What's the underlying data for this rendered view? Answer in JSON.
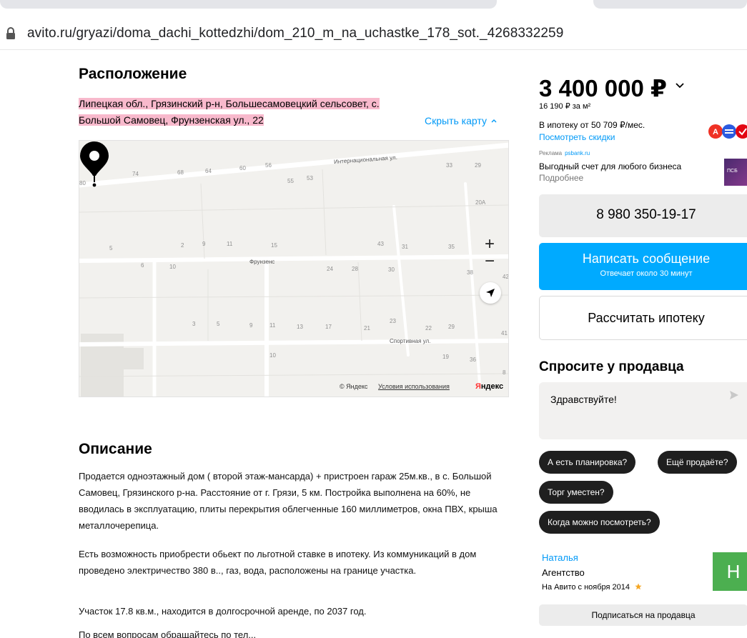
{
  "browser": {
    "url": "avito.ru/gryazi/doma_dachi_kottedzhi/dom_210_m_na_uchastke_178_sot._4268332259"
  },
  "location": {
    "title": "Расположение",
    "address_line1": "Липецкая обл., Грязинский р-н, Большесамовецкий сельсовет, с.",
    "address_line2": "Большой Самовец, Фрунзенская ул., 22",
    "hide_map": "Скрыть карту"
  },
  "map": {
    "street_international": "Интернациональная ул.",
    "street_frunze": "Фрунзенс",
    "street_sport": "Спортивная ул.",
    "house_numbers": [
      "74",
      "68",
      "64",
      "60",
      "56",
      "55",
      "53",
      "33",
      "29",
      "80",
      "20А",
      "5",
      "2",
      "9",
      "11",
      "15",
      "43",
      "31",
      "35",
      "6",
      "10",
      "24",
      "28",
      "30",
      "38",
      "42",
      "3",
      "5",
      "9",
      "11",
      "13",
      "17",
      "21",
      "23",
      "22",
      "29",
      "41",
      "10",
      "19",
      "36",
      "8"
    ],
    "zoom_in": "+",
    "zoom_out": "−",
    "copyright": "© Яндекс",
    "terms": "Условия использования",
    "logo_red": "Я",
    "logo_black": "ндекс"
  },
  "description": {
    "title": "Описание",
    "p1": "Продается одноэтажный дом ( второй этаж-мансарда) + пристроен гараж 25м.кв., в с. Большой Самовец, Грязинского р-на. Расстояние от г. Грязи, 5 км. Постройка выполнена на 60%, не вводилась в эксплуатацию, плиты перекрытия облегченные 160 миллиметров, окна ПВХ, крыша металлочерепица.",
    "p2": "Есть возможность приобрести обьект по льготной ставке в ипотеку. Из коммуникаций в дом проведено электричество 380 в.., газ, вода, расположены на границе участка.",
    "p3": "Участок 17.8 кв.м., находится в долгосрочной аренде, по 2037 год.",
    "p4": "По всем вопросам обращайтесь по тел..."
  },
  "sidebar": {
    "price": "3 400 000 ₽",
    "price_per_m2": "16 190 ₽ за м²",
    "mortgage_text": "В ипотеку от 50 709 ₽/мес.",
    "discounts_link": "Посмотреть скидки",
    "ad_label": "Реклама",
    "ad_domain": "psbank.ru",
    "ad_title": "Выгодный счет для любого бизнеса",
    "ad_more": "Подробнее",
    "ad_thumb_text": "ПСБ",
    "phone": "8 980 350-19-17",
    "write_message": "Написать сообщение",
    "write_sub": "Отвечает около 30 минут",
    "calc_mortgage": "Рассчитать ипотеку",
    "ask_title": "Спросите у продавца",
    "message_placeholder": "Здравствуйте!",
    "chips": [
      "А есть планировка?",
      "Ещё продаёте?",
      "Торг уместен?",
      "Когда можно посмотреть?"
    ],
    "seller_name": "Наталья",
    "seller_type": "Агентство",
    "seller_since": "На Авито с ноября 2014",
    "avatar_letter": "Н",
    "subscribe": "Подписаться на продавца"
  },
  "colors": {
    "link": "#0099f7",
    "primary_button": "#00aaff",
    "address_highlight": "#f8b9cc",
    "avatar": "#4caf50"
  }
}
